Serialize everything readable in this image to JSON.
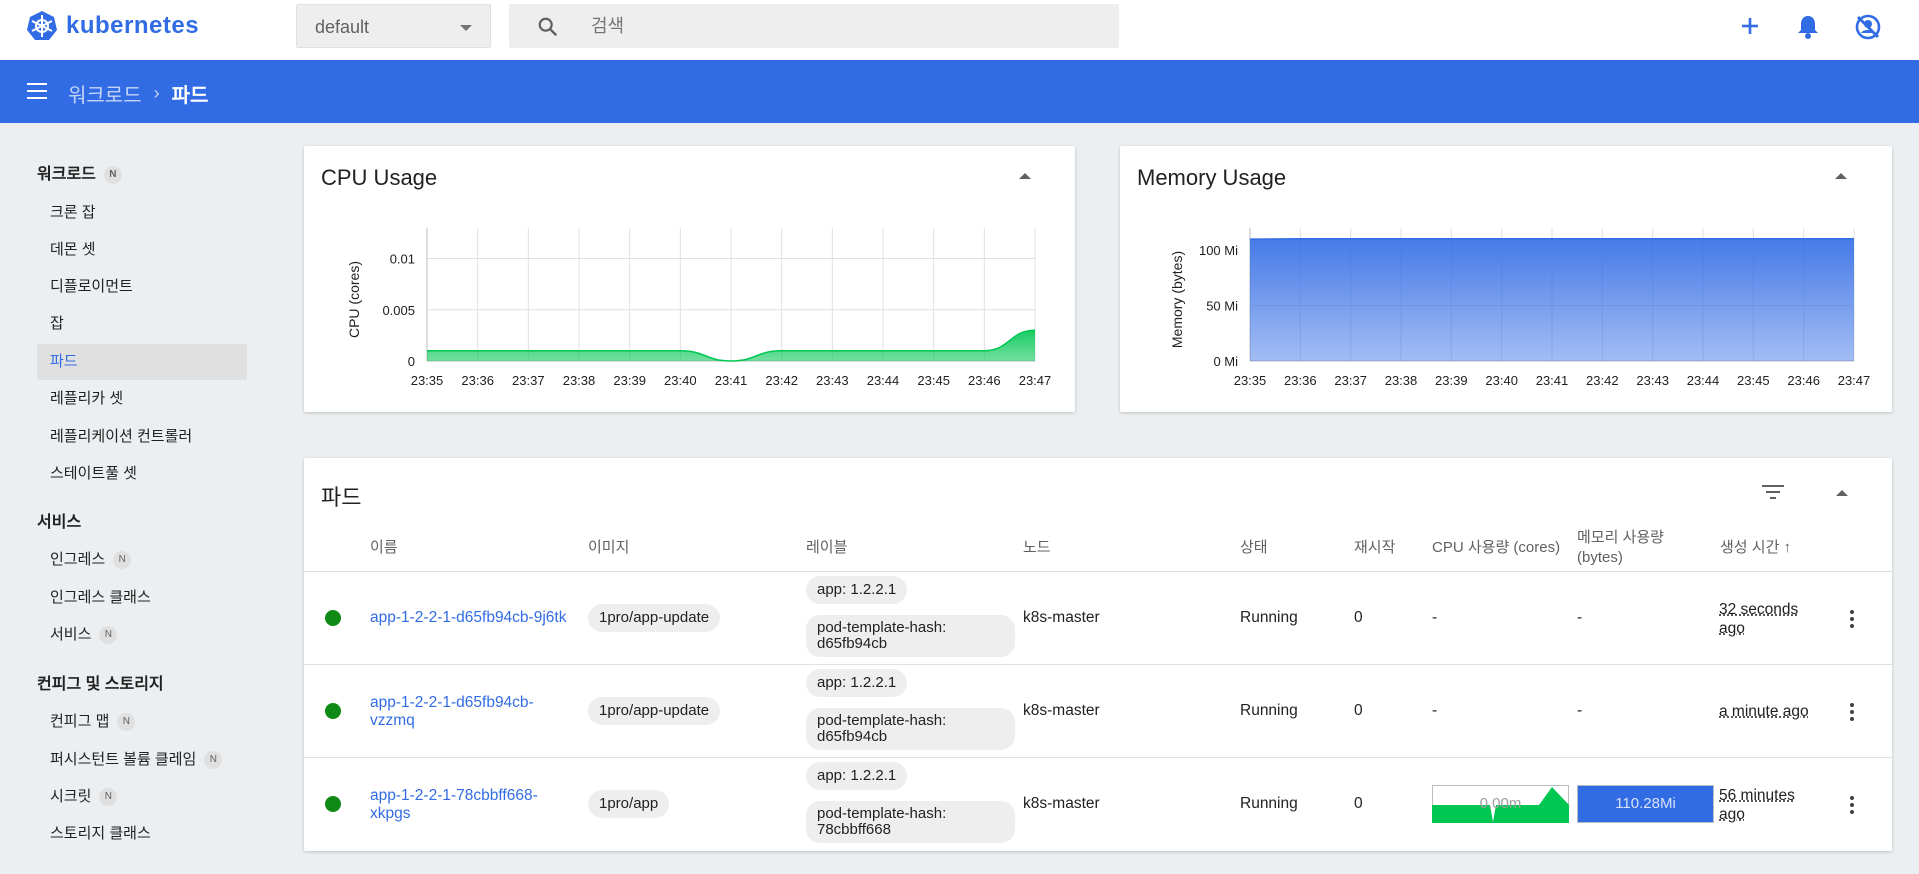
{
  "app": {
    "brand": "kubernetes",
    "namespace": "default",
    "search_placeholder": "검색",
    "icons": [
      "kubernetes-wheel-icon",
      "search-icon",
      "add-icon",
      "bell-icon",
      "account-off-icon"
    ],
    "accent": "#326ce5"
  },
  "breadcrumb": {
    "parent": "워크로드",
    "separator": "›",
    "current": "파드"
  },
  "sidebar": {
    "workloads": {
      "title": "워크로드",
      "badge": "N",
      "items": [
        "크론 잡",
        "데몬 셋",
        "디플로이먼트",
        "잡",
        "파드",
        "레플리카 셋",
        "레플리케이션 컨트롤러",
        "스테이트풀 셋"
      ]
    },
    "services": {
      "title": "서비스",
      "items": [
        {
          "label": "인그레스",
          "badge": "N"
        },
        {
          "label": "인그레스 클래스",
          "badge": ""
        },
        {
          "label": "서비스",
          "badge": "N"
        }
      ]
    },
    "config": {
      "title": "컨피그 및 스토리지",
      "items": [
        {
          "label": "컨피그 맵",
          "badge": "N"
        },
        {
          "label": "퍼시스턴트 볼륨 클레임",
          "badge": "N"
        },
        {
          "label": "시크릿",
          "badge": "N"
        },
        {
          "label": "스토리지 클래스",
          "badge": ""
        }
      ]
    },
    "active": "파드"
  },
  "chart_data": [
    {
      "type": "area",
      "title": "CPU Usage",
      "ylabel": "CPU (cores)",
      "x": [
        "23:35",
        "23:36",
        "23:37",
        "23:38",
        "23:39",
        "23:40",
        "23:41",
        "23:42",
        "23:43",
        "23:44",
        "23:45",
        "23:46",
        "23:47"
      ],
      "values": [
        0.001,
        0.001,
        0.001,
        0.001,
        0.001,
        0.001,
        0.0,
        0.001,
        0.001,
        0.001,
        0.001,
        0.001,
        0.003
      ],
      "yticks": [
        "0",
        "0.005",
        "0.01"
      ],
      "ylim": [
        0,
        0.012
      ],
      "color": "#00c752"
    },
    {
      "type": "area",
      "title": "Memory Usage",
      "ylabel": "Memory (bytes)",
      "x": [
        "23:35",
        "23:36",
        "23:37",
        "23:38",
        "23:39",
        "23:40",
        "23:41",
        "23:42",
        "23:43",
        "23:44",
        "23:45",
        "23:46",
        "23:47"
      ],
      "values": [
        110,
        110.3,
        110.3,
        110.3,
        110.3,
        110.3,
        110.3,
        110.3,
        110.3,
        110.3,
        110.3,
        110.3,
        110.3
      ],
      "yticks": [
        "0 Mi",
        "50 Mi",
        "100 Mi"
      ],
      "ylim": [
        0,
        111
      ],
      "color": "#326ce5"
    }
  ],
  "pods": {
    "title": "파드",
    "headers": [
      "이름",
      "이미지",
      "레이블",
      "노드",
      "상태",
      "재시작",
      "CPU 사용량 (cores)",
      "메모리 사용량 (bytes)",
      "생성 시간 ↑"
    ],
    "rows": [
      {
        "name": "app-1-2-2-1-d65fb94cb-9j6tk",
        "image": "1pro/app-update",
        "label1": "app: 1.2.2.1",
        "label2": "pod-template-hash: d65fb94cb",
        "node": "k8s-master",
        "status": "Running",
        "restarts": "0",
        "cpu": "-",
        "memory": "-",
        "age": "32 seconds ago"
      },
      {
        "name": "app-1-2-2-1-d65fb94cb-vzzmq",
        "image": "1pro/app-update",
        "label1": "app: 1.2.2.1",
        "label2": "pod-template-hash: d65fb94cb",
        "node": "k8s-master",
        "status": "Running",
        "restarts": "0",
        "cpu": "-",
        "memory": "-",
        "age": "a minute ago"
      },
      {
        "name": "app-1-2-2-1-78cbbff668-xkpgs",
        "image": "1pro/app",
        "label1": "app: 1.2.2.1",
        "label2": "pod-template-hash: 78cbbff668",
        "node": "k8s-master",
        "status": "Running",
        "restarts": "0",
        "cpu": "0.00m",
        "memory": "110.28Mi",
        "age": "56 minutes ago"
      }
    ],
    "status_color": "#0f8a16"
  }
}
